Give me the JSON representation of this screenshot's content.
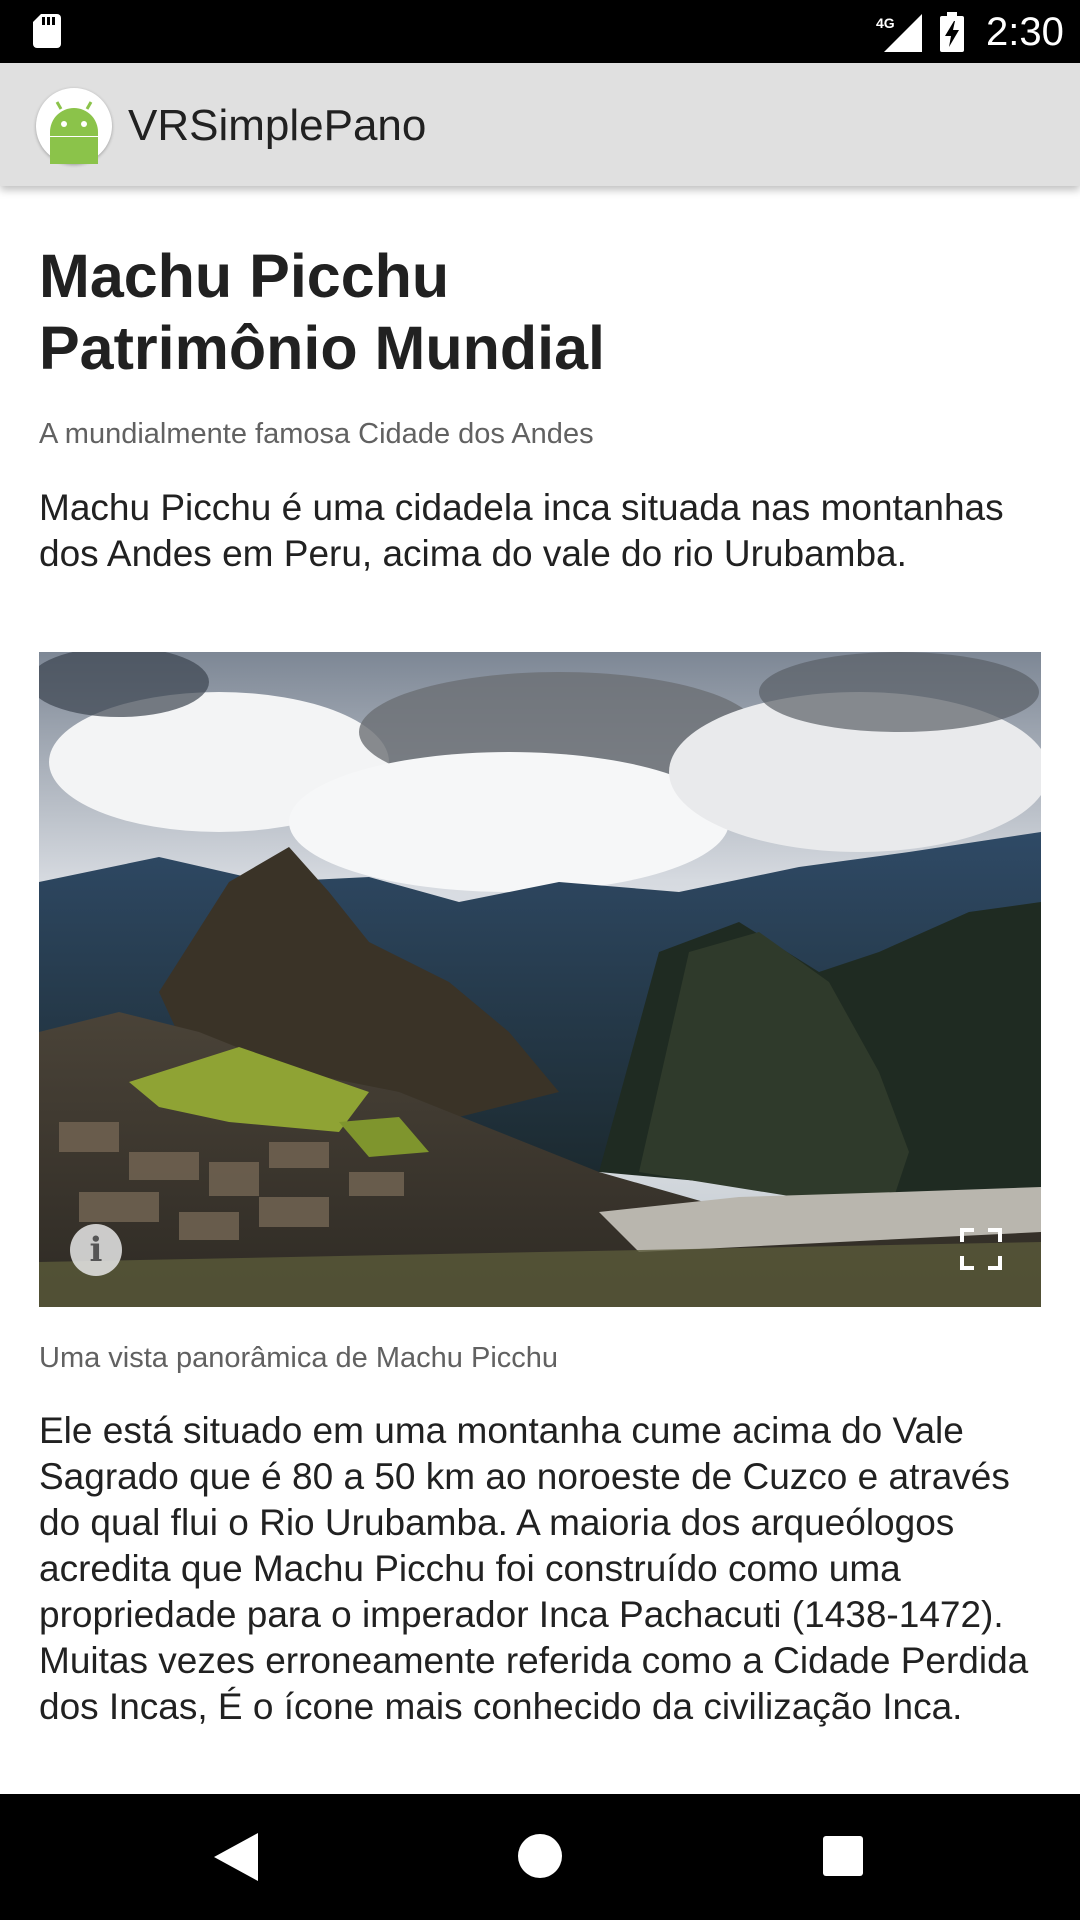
{
  "status_bar": {
    "time": "2:30",
    "network_label": "4G",
    "icons": [
      "sd-card-icon",
      "cell-signal-icon",
      "battery-charging-icon"
    ]
  },
  "app_bar": {
    "title": "VRSimplePano",
    "logo_icon": "android-icon",
    "logo_color": "#8bc34a"
  },
  "article": {
    "title_line1": "Machu Picchu",
    "title_line2": "Patrimônio Mundial",
    "subtitle": "A mundialmente famosa Cidade dos Andes",
    "intro": "Machu Picchu é uma cidadela inca situada nas montanhas dos Andes em Peru, acima do vale do rio Urubamba.",
    "panorama": {
      "info_icon": "info-icon",
      "fullscreen_icon": "fullscreen-icon",
      "info_label": "i"
    },
    "caption": "Uma vista panorâmica de Machu Picchu",
    "body": "Ele está situado em uma montanha cume acima do Vale Sagrado que é 80 a 50 km ao noroeste de Cuzco e através do qual flui o Rio Urubamba. A maioria dos arqueólogos acredita que Machu Picchu foi construído como uma propriedade para o imperador Inca Pachacuti (1438-1472). Muitas vezes erroneamente referida como a Cidade Perdida dos Incas, É o ícone mais conhecido da civilização Inca."
  },
  "nav_bar": {
    "buttons": [
      "back-icon",
      "home-icon",
      "recents-icon"
    ]
  }
}
